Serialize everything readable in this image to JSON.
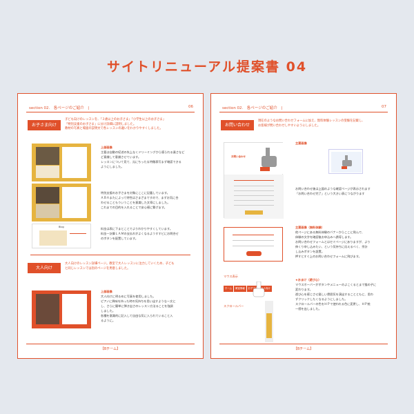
{
  "main_title": "サイトリニューアル提案書 04",
  "left_page": {
    "section_label": "section 02.　各ページのご紹介　|",
    "page_number": "06",
    "badge_kids": "お子さま向け",
    "intro_kids": [
      "子ども向けのレッスンを、「３歳以上のお子さま」「小学生以上のお子さま」",
      "「特別支援のお子さま」に分け詳細に説明しました。",
      "教材の写真と場面の説明文で各レッスンの違いをわかりやすくしました。"
    ],
    "block1_heading": "上部画像",
    "block1_text": [
      "主要は自動の紀述の先上なくドリーミングから感られる楽さなど",
      "ど意識して意識させています。",
      "レッスンについて見て、元にちった＆特徴表写まず確認できる",
      "ようにしました。"
    ],
    "block2_text": [
      "特別支援のお子さまを対象にここに記載しています。",
      "ＡＢＡまたによって特性はさまざまですので、まずお気に合",
      "わせることもういうことを意識した文章にしました。",
      "これまでの目的を入れることで安心感に繋げます。"
    ],
    "block3_text": [
      "料金は表に下まとことでよりわかりやすくしています。",
      "料金一計算ＬＡＭの支払わがよくなるようすすビにお問合せ",
      "のボタンを配置しています。"
    ],
    "badge_adults": "大人向け",
    "intro_adults": [
      "大人向けのレッスン詳細ページ。教室で大人レッスンに注力していくため、子ども",
      "と同じレッスンでは別のページを用意しました。"
    ],
    "block4_heading": "上部画像",
    "block4_text": [
      "大人向けに明るめに写真を使用しました。",
      "ピアノに興味を持った時の気持ちを思い出すようなー文に",
      "し、さらに簡単に弾き出さのレッスン方法ることを強調",
      "しました。",
      "各種を意識的に記入して自由な気に入られていること入",
      "るように。"
    ],
    "thumb_label": "Blog",
    "footer": "【Bチーム】"
  },
  "right_page": {
    "section_label": "section 02.　各ページのご紹介　|",
    "page_number": "07",
    "badge_contact": "お問い合わせ",
    "intro_contact": [
      "現在のようなお問い合わせフォームに加え、無料体験レッスンの受験を記載し、",
      "お客様が問い合わせしやすいようにしました。"
    ],
    "thumb_contact_title": "お問い合わせ",
    "block1_heading": "主要画像",
    "block1_text": [
      "お問い合わせ後は上図のような確認ページが表示されます",
      "「お問い合わせ完了」という大きい表につながります"
    ],
    "block2_heading": "主要画像（無料体験）",
    "block2_text": [
      "他ページにある無料体験のバナーからここに飛んで、",
      "体験の文字を確認後お申込みへ誘導します。",
      "お問い合わせフォームとはセミページにありますが、より",
      "伸くり申し込みたい、という気持ちに応えるべく、余計",
      "し込みボタンを設置。",
      "押すとすぐ上のお問い合わせフォームに飛びます。"
    ],
    "block3_heading": "★おまけ（遊び心）",
    "block3_text": [
      "マウスホーバーがボタンやメニューのよこくるとまで猫の子に",
      "変わります。",
      "遊び心を感じさせ楽しい雰囲気を演出することともに、思わ",
      "ずクリックしたくなるようにしました。",
      "スクロールバーの色をＨＰで使われる色に変更し、ＨＰ統",
      "一感を出しました。"
    ],
    "mouse_label": "マウス表示",
    "scroll_label": "スクロールバー",
    "nav_tabs": [
      "ホーム",
      "教室情報",
      "お子さま",
      "大人向け"
    ],
    "footer": "【Bチーム】"
  }
}
